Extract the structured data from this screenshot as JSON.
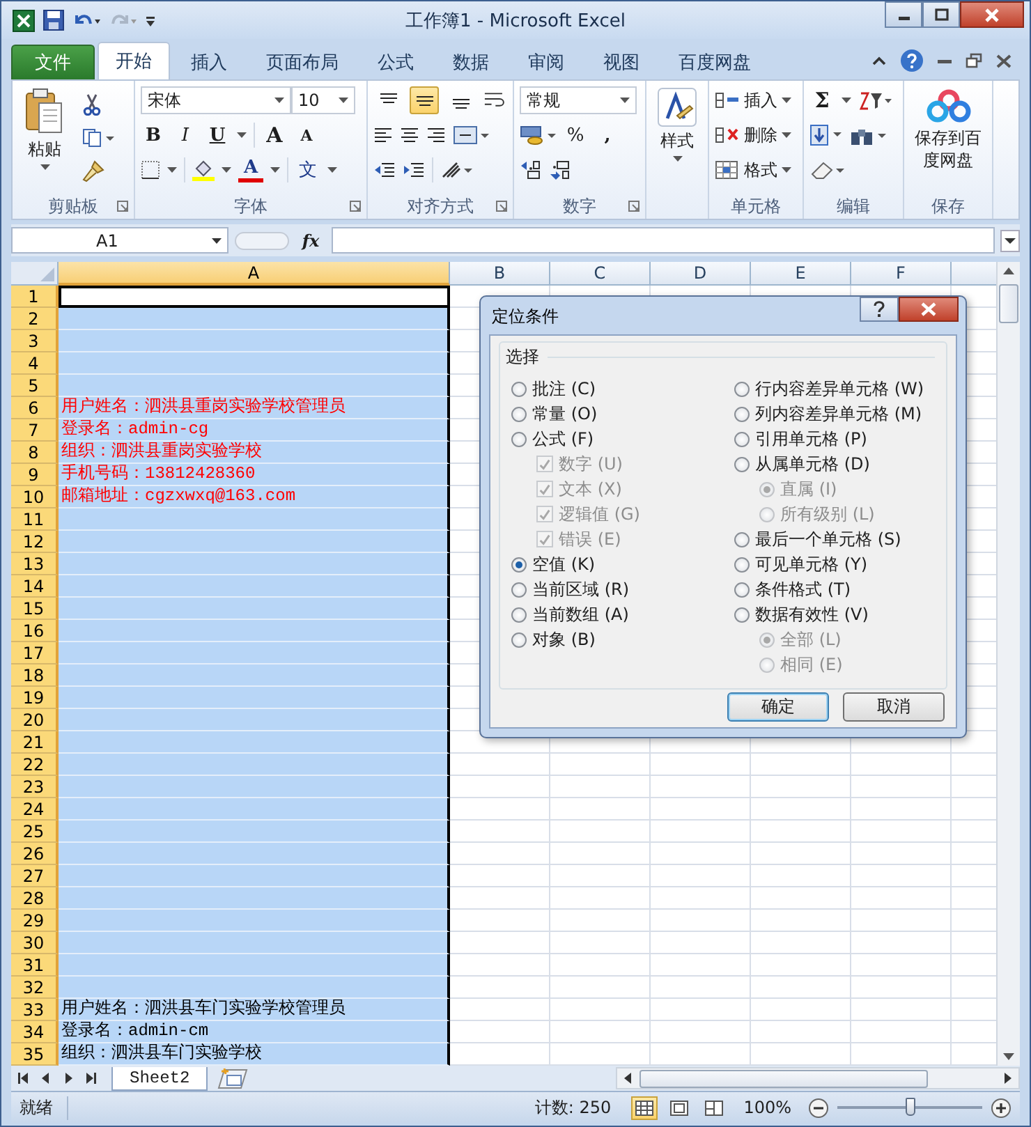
{
  "window": {
    "title": "工作簿1 - Microsoft Excel"
  },
  "ribbon_tabs": [
    {
      "label": "文件",
      "kind": "file",
      "selected": false
    },
    {
      "label": "开始",
      "kind": "tab",
      "selected": true
    },
    {
      "label": "插入",
      "kind": "tab",
      "selected": false
    },
    {
      "label": "页面布局",
      "kind": "tab",
      "selected": false
    },
    {
      "label": "公式",
      "kind": "tab",
      "selected": false
    },
    {
      "label": "数据",
      "kind": "tab",
      "selected": false
    },
    {
      "label": "审阅",
      "kind": "tab",
      "selected": false
    },
    {
      "label": "视图",
      "kind": "tab",
      "selected": false
    },
    {
      "label": "百度网盘",
      "kind": "tab",
      "selected": false
    }
  ],
  "ribbon": {
    "clipboard": {
      "title": "剪贴板",
      "paste": "粘贴"
    },
    "font": {
      "title": "字体",
      "font_name": "宋体",
      "font_size": "10",
      "bold": "B",
      "italic": "I",
      "underline": "U",
      "grow_font": "A",
      "shrink_font": "A",
      "font_color": "A",
      "phonetic": "文"
    },
    "alignment": {
      "title": "对齐方式",
      "vertical_align": [
        {
          "selected": false
        },
        {
          "selected": true
        },
        {
          "selected": false
        }
      ]
    },
    "number": {
      "title": "数字",
      "format": "常规",
      "percent": "%",
      "comma": ","
    },
    "styles": {
      "label": "样式"
    },
    "cells": {
      "title": "单元格",
      "insert": "插入",
      "delete": "删除",
      "format": "格式"
    },
    "editing": {
      "title": "编辑",
      "sum": "Σ"
    },
    "save": {
      "title": "保存",
      "label": "保存到百度网盘"
    }
  },
  "formula_bar": {
    "name_box": "A1",
    "fx": "fx"
  },
  "columns": [
    {
      "label": "A",
      "selected": true
    },
    {
      "label": "B",
      "selected": false
    },
    {
      "label": "C",
      "selected": false
    },
    {
      "label": "D",
      "selected": false
    },
    {
      "label": "E",
      "selected": false
    },
    {
      "label": "F",
      "selected": false
    }
  ],
  "rows": [
    {
      "number": "1",
      "selected": true,
      "active": true
    },
    {
      "number": "2",
      "selected": true,
      "active": false
    },
    {
      "number": "3",
      "selected": true,
      "active": false
    },
    {
      "number": "4",
      "selected": true,
      "active": false
    },
    {
      "number": "5",
      "selected": true,
      "active": false
    },
    {
      "number": "6",
      "selected": true,
      "active": false,
      "text": "用户姓名：泗洪县重岗实验学校管理员",
      "color": "#ff0000"
    },
    {
      "number": "7",
      "selected": true,
      "active": false,
      "text": "登录名：admin-cg",
      "color": "#ff0000"
    },
    {
      "number": "8",
      "selected": true,
      "active": false,
      "text": "组织：泗洪县重岗实验学校",
      "color": "#ff0000"
    },
    {
      "number": "9",
      "selected": true,
      "active": false,
      "text": "手机号码：13812428360",
      "color": "#ff0000"
    },
    {
      "number": "10",
      "selected": true,
      "active": false,
      "text": "邮箱地址：cgzxwxq@163.com",
      "color": "#ff0000"
    },
    {
      "number": "11",
      "selected": true,
      "active": false
    },
    {
      "number": "12",
      "selected": true,
      "active": false
    },
    {
      "number": "13",
      "selected": true,
      "active": false
    },
    {
      "number": "14",
      "selected": true,
      "active": false
    },
    {
      "number": "15",
      "selected": true,
      "active": false
    },
    {
      "number": "16",
      "selected": true,
      "active": false
    },
    {
      "number": "17",
      "selected": true,
      "active": false
    },
    {
      "number": "18",
      "selected": true,
      "active": false
    },
    {
      "number": "19",
      "selected": true,
      "active": false
    },
    {
      "number": "20",
      "selected": true,
      "active": false
    },
    {
      "number": "21",
      "selected": true,
      "active": false
    },
    {
      "number": "22",
      "selected": true,
      "active": false
    },
    {
      "number": "23",
      "selected": true,
      "active": false
    },
    {
      "number": "24",
      "selected": true,
      "active": false
    },
    {
      "number": "25",
      "selected": true,
      "active": false
    },
    {
      "number": "26",
      "selected": true,
      "active": false
    },
    {
      "number": "27",
      "selected": true,
      "active": false
    },
    {
      "number": "28",
      "selected": true,
      "active": false
    },
    {
      "number": "29",
      "selected": true,
      "active": false
    },
    {
      "number": "30",
      "selected": true,
      "active": false
    },
    {
      "number": "31",
      "selected": true,
      "active": false
    },
    {
      "number": "32",
      "selected": true,
      "active": false
    },
    {
      "number": "33",
      "selected": true,
      "active": false,
      "text": "用户姓名：泗洪县车门实验学校管理员",
      "color": "#000000"
    },
    {
      "number": "34",
      "selected": true,
      "active": false,
      "text": "登录名：admin-cm",
      "color": "#000000"
    },
    {
      "number": "35",
      "selected": true,
      "active": false,
      "text": "组织：泗洪县车门实验学校",
      "color": "#000000"
    }
  ],
  "dialog": {
    "title": "定位条件",
    "group_label": "选择",
    "left_options": [
      {
        "label": "批注 (C)",
        "kind": "radio",
        "selected": false,
        "disabled": false
      },
      {
        "label": "常量 (O)",
        "kind": "radio",
        "selected": false,
        "disabled": false
      },
      {
        "label": "公式 (F)",
        "kind": "radio",
        "selected": false,
        "disabled": false,
        "children": [
          {
            "label": "数字 (U)",
            "kind": "checkbox",
            "checked": true,
            "disabled": true
          },
          {
            "label": "文本 (X)",
            "kind": "checkbox",
            "checked": true,
            "disabled": true
          },
          {
            "label": "逻辑值 (G)",
            "kind": "checkbox",
            "checked": true,
            "disabled": true
          },
          {
            "label": "错误 (E)",
            "kind": "checkbox",
            "checked": true,
            "disabled": true
          }
        ]
      },
      {
        "label": "空值 (K)",
        "kind": "radio",
        "selected": true,
        "disabled": false
      },
      {
        "label": "当前区域 (R)",
        "kind": "radio",
        "selected": false,
        "disabled": false
      },
      {
        "label": "当前数组 (A)",
        "kind": "radio",
        "selected": false,
        "disabled": false
      },
      {
        "label": "对象 (B)",
        "kind": "radio",
        "selected": false,
        "disabled": false
      }
    ],
    "right_options": [
      {
        "label": "行内容差异单元格 (W)",
        "kind": "radio",
        "selected": false,
        "disabled": false
      },
      {
        "label": "列内容差异单元格 (M)",
        "kind": "radio",
        "selected": false,
        "disabled": false
      },
      {
        "label": "引用单元格 (P)",
        "kind": "radio",
        "selected": false,
        "disabled": false
      },
      {
        "label": "从属单元格 (D)",
        "kind": "radio",
        "selected": false,
        "disabled": false,
        "children": [
          {
            "label": "直属 (I)",
            "kind": "radio",
            "selected": true,
            "disabled": true
          },
          {
            "label": "所有级别 (L)",
            "kind": "radio",
            "selected": false,
            "disabled": true
          }
        ]
      },
      {
        "label": "最后一个单元格 (S)",
        "kind": "radio",
        "selected": false,
        "disabled": false
      },
      {
        "label": "可见单元格 (Y)",
        "kind": "radio",
        "selected": false,
        "disabled": false
      },
      {
        "label": "条件格式 (T)",
        "kind": "radio",
        "selected": false,
        "disabled": false
      },
      {
        "label": "数据有效性 (V)",
        "kind": "radio",
        "selected": false,
        "disabled": false,
        "children": [
          {
            "label": "全部 (L)",
            "kind": "radio",
            "selected": true,
            "disabled": true
          },
          {
            "label": "相同 (E)",
            "kind": "radio",
            "selected": false,
            "disabled": true
          }
        ]
      }
    ],
    "buttons": [
      {
        "label": "确定",
        "default": true
      },
      {
        "label": "取消",
        "default": false
      }
    ]
  },
  "sheet_tabs": [
    {
      "label": "Sheet2",
      "selected": true
    }
  ],
  "status_bar": {
    "status": "就绪",
    "count": "计数: 250",
    "views": [
      {
        "selected": true
      },
      {
        "selected": false
      },
      {
        "selected": false
      }
    ],
    "zoom": "100%",
    "zoom_slider": {
      "level": 0.5
    }
  }
}
